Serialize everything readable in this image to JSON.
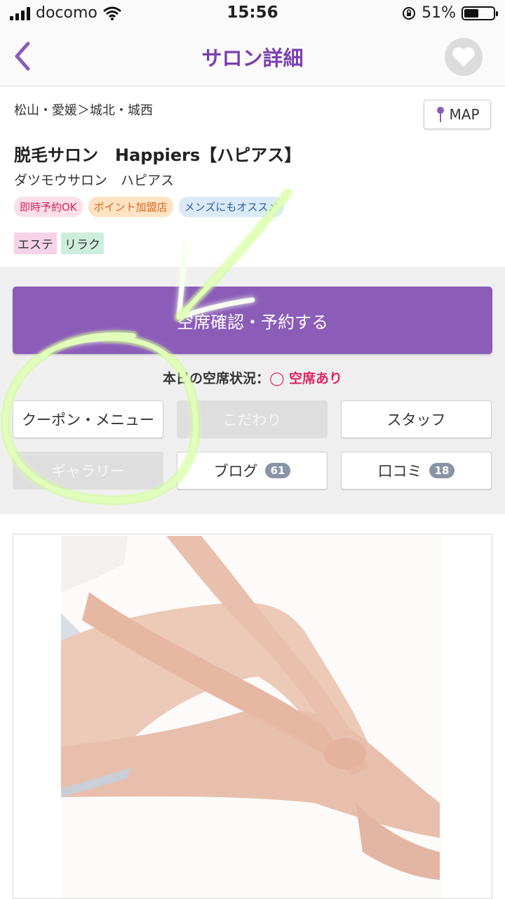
{
  "status_bar": {
    "carrier": "docomo",
    "time": "15:56",
    "battery": "51%",
    "battery_level": 0.51
  },
  "nav": {
    "title": "サロン詳細"
  },
  "salon": {
    "breadcrumb": "松山・愛媛＞城北・城西",
    "map_label": "MAP",
    "name": "脱毛サロン　Happiers【ハピアス】",
    "kana": "ダツモウサロン　ハピアス",
    "tags": [
      {
        "label": "即時予約OK",
        "bg": "#fbe0e8",
        "color": "#d6245c"
      },
      {
        "label": "ポイント加盟店",
        "bg": "#fde3c4",
        "color": "#e0651c"
      },
      {
        "label": "メンズにもオススメ",
        "bg": "#dbeaf8",
        "color": "#2f5f9e"
      }
    ],
    "categories": [
      {
        "label": "エステ",
        "bg": "#f6d3e6"
      },
      {
        "label": "リラク",
        "bg": "#cdeedd"
      }
    ]
  },
  "actions": {
    "reserve_label": "空席確認・予約する",
    "availability_prefix": "本日の空席状況：",
    "availability_status": "◯ 空席あり",
    "buttons": {
      "coupon": "クーポン・メニュー",
      "kodawari": "こだわり",
      "staff": "スタッフ",
      "gallery": "ギャラリー",
      "blog": "ブログ",
      "blog_count": "61",
      "review": "口コミ",
      "review_count": "18"
    }
  },
  "colors": {
    "accent": "#8b5cb8",
    "title": "#7b3fb0",
    "available": "#e0245e",
    "annotation": "#f7fff0"
  }
}
